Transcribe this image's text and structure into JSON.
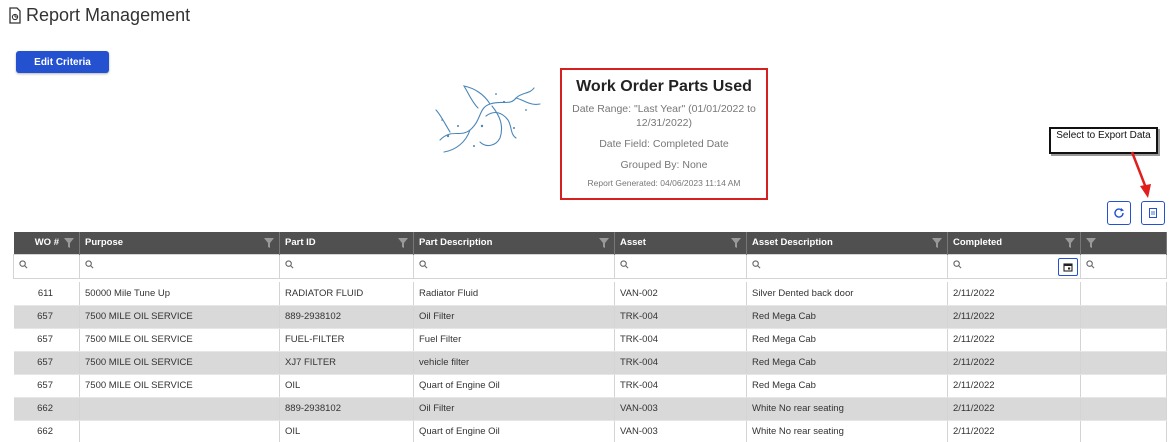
{
  "header": {
    "title": "Report Management",
    "icon": "report-doc-icon"
  },
  "toolbar": {
    "edit_label": "Edit Criteria"
  },
  "report": {
    "title": "Work Order Parts Used",
    "date_range": "Date Range: \"Last Year\" (01/01/2022 to 12/31/2022)",
    "date_field": "Date Field: Completed Date",
    "grouped_by": "Grouped By: None",
    "generated": "Report Generated: 04/06/2023 11:14 AM"
  },
  "callout": {
    "text": "Select to Export Data"
  },
  "colors": {
    "accent": "#2451d0",
    "header_bg": "#505050",
    "callout_border": "#d61f1f",
    "row_alt": "#d9d9d9"
  },
  "table": {
    "columns": [
      "WO #",
      "Purpose",
      "Part ID",
      "Part Description",
      "Asset",
      "Asset Description",
      "Completed",
      ""
    ],
    "rows": [
      [
        "611",
        "50000 Mile Tune Up",
        "RADIATOR FLUID",
        "Radiator Fluid",
        "VAN-002",
        "Silver Dented back door",
        "2/11/2022",
        ""
      ],
      [
        "657",
        "7500 MILE OIL SERVICE",
        "889-2938102",
        "Oil Filter",
        "TRK-004",
        "Red Mega Cab",
        "2/11/2022",
        ""
      ],
      [
        "657",
        "7500 MILE OIL SERVICE",
        "FUEL-FILTER",
        "Fuel Filter",
        "TRK-004",
        "Red Mega Cab",
        "2/11/2022",
        ""
      ],
      [
        "657",
        "7500 MILE OIL SERVICE",
        "XJ7 FILTER",
        "vehicle filter",
        "TRK-004",
        "Red Mega Cab",
        "2/11/2022",
        ""
      ],
      [
        "657",
        "7500 MILE OIL SERVICE",
        "OIL",
        "Quart of Engine Oil",
        "TRK-004",
        "Red Mega Cab",
        "2/11/2022",
        ""
      ],
      [
        "662",
        "",
        "889-2938102",
        "Oil Filter",
        "VAN-003",
        "White No rear seating",
        "2/11/2022",
        ""
      ],
      [
        "662",
        "",
        "OIL",
        "Quart of Engine Oil",
        "VAN-003",
        "White No rear seating",
        "2/11/2022",
        ""
      ]
    ]
  }
}
